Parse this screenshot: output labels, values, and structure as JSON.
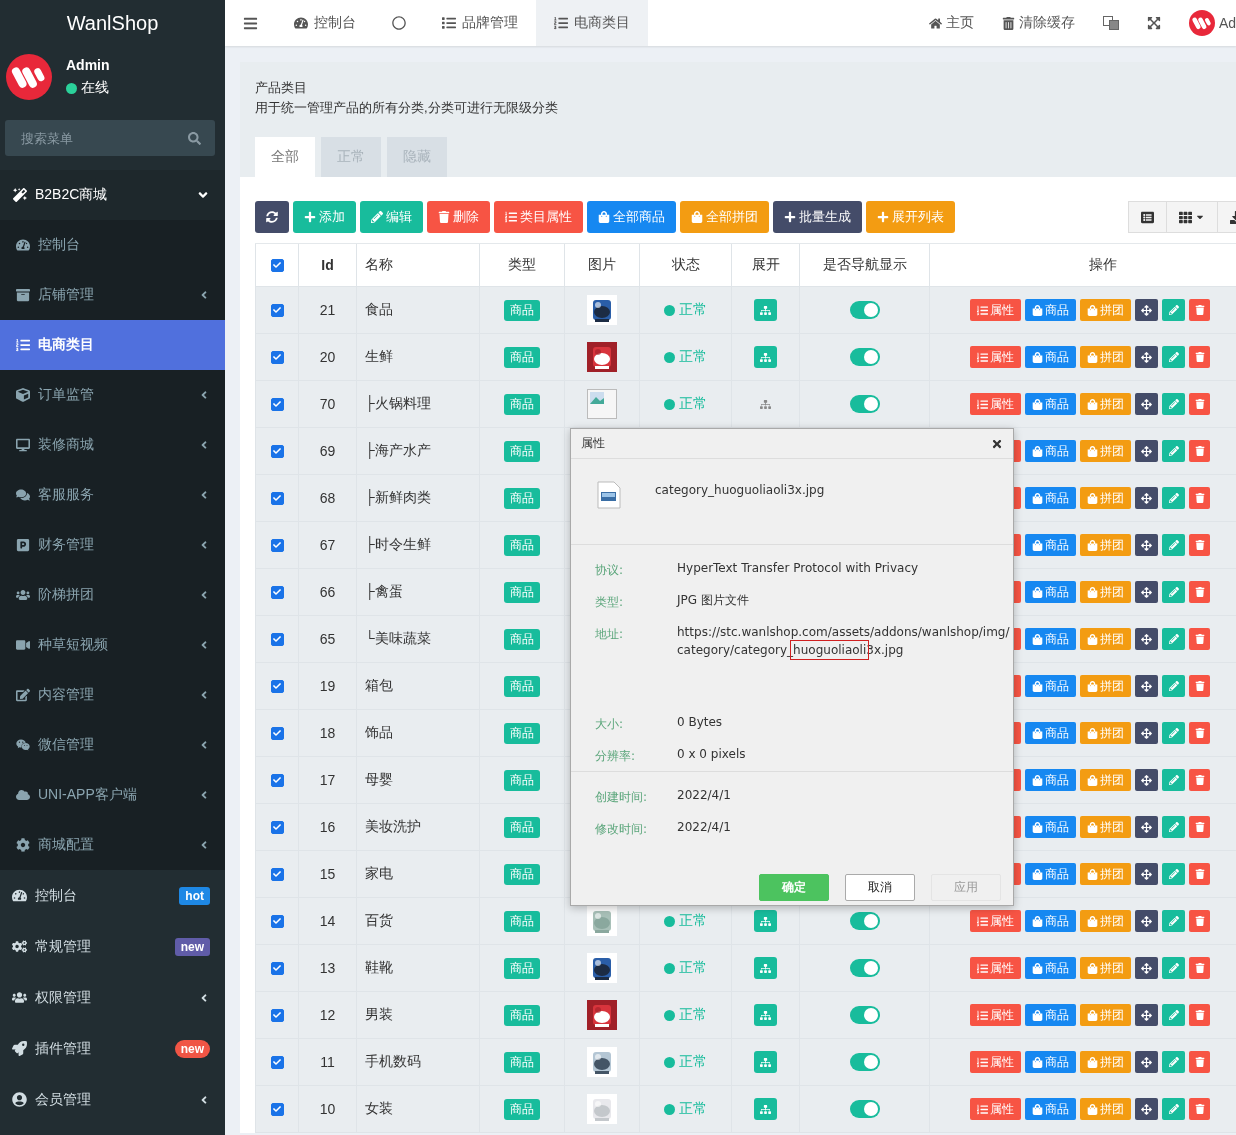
{
  "sidebar": {
    "brand": "WanlShop",
    "user": {
      "name": "Admin",
      "status": "在线"
    },
    "search": {
      "placeholder": "搜索菜单"
    },
    "group": {
      "label": "B2B2C商城",
      "expanded": true,
      "items": [
        {
          "label": "控制台",
          "has_children": false,
          "selected": false
        },
        {
          "label": "店铺管理",
          "has_children": true,
          "selected": false
        },
        {
          "label": "电商类目",
          "has_children": false,
          "selected": true
        },
        {
          "label": "订单监管",
          "has_children": true,
          "selected": false
        },
        {
          "label": "装修商城",
          "has_children": true,
          "selected": false
        },
        {
          "label": "客服服务",
          "has_children": true,
          "selected": false
        },
        {
          "label": "财务管理",
          "has_children": true,
          "selected": false
        },
        {
          "label": "阶梯拼团",
          "has_children": true,
          "selected": false
        },
        {
          "label": "种草短视频",
          "has_children": true,
          "selected": false
        },
        {
          "label": "内容管理",
          "has_children": true,
          "selected": false
        },
        {
          "label": "微信管理",
          "has_children": true,
          "selected": false
        },
        {
          "label": "UNI-APP客户端",
          "has_children": true,
          "selected": false
        },
        {
          "label": "商城配置",
          "has_children": true,
          "selected": false
        }
      ]
    },
    "items": [
      {
        "label": "控制台",
        "has_children": false,
        "badge": {
          "text": "hot",
          "color": "#1e88e5",
          "rounded": false
        }
      },
      {
        "label": "常规管理",
        "has_children": false,
        "badge": {
          "text": "new",
          "color": "#605ca8",
          "rounded": false
        }
      },
      {
        "label": "权限管理",
        "has_children": true
      },
      {
        "label": "插件管理",
        "has_children": false,
        "badge": {
          "text": "new",
          "color": "#f05545",
          "rounded": true
        }
      },
      {
        "label": "会员管理",
        "has_children": true
      }
    ]
  },
  "topbar": {
    "tabs": [
      {
        "label": "控制台",
        "selected": false
      },
      {
        "selected": false
      },
      {
        "label": "品牌管理",
        "selected": false
      },
      {
        "label": "电商类目",
        "selected": true
      }
    ],
    "links": [
      {
        "label": "主页"
      },
      {
        "label": "清除缓存"
      }
    ],
    "user": "Ad"
  },
  "panel": {
    "title": "产品类目",
    "description": "用于统一管理产品的所有分类,分类可进行无限级分类",
    "tabs": [
      {
        "label": "全部",
        "selected": true
      },
      {
        "label": "正常",
        "selected": false
      },
      {
        "label": "隐藏",
        "selected": false
      }
    ],
    "toolbar": [
      {
        "color": "#444c69"
      },
      {
        "label": "添加",
        "color": "#18bc9c"
      },
      {
        "label": "编辑",
        "color": "#18bc9c"
      },
      {
        "label": "删除",
        "color": "#f75444"
      },
      {
        "label": "类目属性",
        "color": "#f75444"
      },
      {
        "label": "全部商品",
        "color": "#1688f1"
      },
      {
        "label": "全部拼团",
        "color": "#f39c12"
      },
      {
        "label": "批量生成",
        "color": "#444c69"
      },
      {
        "label": "展开列表",
        "color": "#f39c12"
      }
    ],
    "table": {
      "all_checked": true,
      "columns": [
        "Id",
        "名称",
        "类型",
        "图片",
        "状态",
        "展开",
        "是否导航显示",
        "操作"
      ],
      "rows": [
        {
          "checked": true,
          "id": "21",
          "name": "食品",
          "type": "商品",
          "image": {
            "kind": "picture"
          },
          "status": "正常",
          "expandable": true,
          "nav": true,
          "actions": [
            "属性",
            "商品",
            "拼团"
          ]
        },
        {
          "checked": true,
          "id": "20",
          "name": "生鲜",
          "type": "商品",
          "image": {
            "kind": "picture"
          },
          "status": "正常",
          "expandable": true,
          "nav": true,
          "actions": [
            "属性",
            "商品",
            "拼团"
          ]
        },
        {
          "checked": true,
          "id": "70",
          "name": "├火锅料理",
          "type": "商品",
          "image": {
            "kind": "broken"
          },
          "status": "正常",
          "expandable": false,
          "nav": true,
          "actions": [
            "属性",
            "商品",
            "拼团"
          ]
        },
        {
          "checked": true,
          "id": "69",
          "name": "├海产水产",
          "type": "商品",
          "actions": [
            "商品",
            "拼团"
          ]
        },
        {
          "checked": true,
          "id": "68",
          "name": "├新鲜肉类",
          "type": "商品",
          "actions": [
            "商品",
            "拼团"
          ]
        },
        {
          "checked": true,
          "id": "67",
          "name": "├时令生鲜",
          "type": "商品",
          "actions": [
            "商品",
            "拼团"
          ]
        },
        {
          "checked": true,
          "id": "66",
          "name": "├禽蛋",
          "type": "商品",
          "actions": [
            "商品",
            "拼团"
          ]
        },
        {
          "checked": true,
          "id": "65",
          "name": "└美味蔬菜",
          "type": "商品",
          "actions": [
            "商品",
            "拼团"
          ]
        },
        {
          "checked": true,
          "id": "19",
          "name": "箱包",
          "type": "商品",
          "actions": [
            "商品",
            "拼团"
          ]
        },
        {
          "checked": true,
          "id": "18",
          "name": "饰品",
          "type": "商品",
          "actions": [
            "商品",
            "拼团"
          ]
        },
        {
          "checked": true,
          "id": "17",
          "name": "母婴",
          "type": "商品",
          "actions": [
            "商品",
            "拼团"
          ]
        },
        {
          "checked": true,
          "id": "16",
          "name": "美妆洗护",
          "type": "商品",
          "actions": [
            "商品",
            "拼团"
          ]
        },
        {
          "checked": true,
          "id": "15",
          "name": "家电",
          "type": "商品",
          "actions": [
            "商品",
            "拼团"
          ]
        },
        {
          "checked": true,
          "id": "14",
          "name": "百货",
          "type": "商品",
          "image": {
            "kind": "picture"
          },
          "status": "正常",
          "expandable": true,
          "nav": true,
          "actions": [
            "属性",
            "商品",
            "拼团"
          ]
        },
        {
          "checked": true,
          "id": "13",
          "name": "鞋靴",
          "type": "商品",
          "image": {
            "kind": "picture"
          },
          "status": "正常",
          "expandable": true,
          "nav": true,
          "actions": [
            "属性",
            "商品",
            "拼团"
          ]
        },
        {
          "checked": true,
          "id": "12",
          "name": "男装",
          "type": "商品",
          "image": {
            "kind": "picture"
          },
          "status": "正常",
          "expandable": true,
          "nav": true,
          "actions": [
            "属性",
            "商品",
            "拼团"
          ]
        },
        {
          "checked": true,
          "id": "11",
          "name": "手机数码",
          "type": "商品",
          "image": {
            "kind": "picture"
          },
          "status": "正常",
          "expandable": true,
          "nav": true,
          "actions": [
            "属性",
            "商品",
            "拼团"
          ]
        },
        {
          "checked": true,
          "id": "10",
          "name": "女装",
          "type": "商品",
          "image": {
            "kind": "picture"
          },
          "status": "正常",
          "expandable": true,
          "nav": true,
          "actions": [
            "属性",
            "商品",
            "拼团"
          ]
        }
      ]
    }
  },
  "dialog": {
    "title": "属性",
    "file_name": "category_huoguoliaoli3x.jpg",
    "sections": [
      {
        "fields": [
          {
            "kind": "text",
            "label": "协议:",
            "value": "HyperText Transfer Protocol with Privacy"
          },
          {
            "kind": "text",
            "label": "类型:",
            "value": "JPG 图片文件"
          },
          {
            "kind": "address",
            "label": "地址:",
            "lines": [
              [
                {
                  "kind": "plain",
                  "text": "https://stc.wanlshop.com/assets/addons/wanlshop/img/"
                }
              ],
              [
                {
                  "kind": "plain",
                  "text": "category/category_"
                },
                {
                  "kind": "boxed",
                  "text": "huoguoliaoli"
                },
                {
                  "kind": "plain",
                  "text": "3x.jpg"
                }
              ]
            ]
          },
          {
            "kind": "text",
            "label": "大小:",
            "value": "0 Bytes"
          },
          {
            "kind": "text",
            "label": "分辨率:",
            "value": "0 x 0 pixels"
          }
        ]
      },
      {
        "fields": [
          {
            "kind": "text",
            "label": "创建时间:",
            "value": "2022/4/1"
          },
          {
            "kind": "text",
            "label": "修改时间:",
            "value": "2022/4/1"
          }
        ]
      }
    ],
    "buttons": [
      {
        "label": "确定",
        "kind": "primary",
        "disabled": false
      },
      {
        "label": "取消",
        "kind": "default",
        "disabled": false
      },
      {
        "label": "应用",
        "kind": "default",
        "disabled": true
      }
    ]
  }
}
